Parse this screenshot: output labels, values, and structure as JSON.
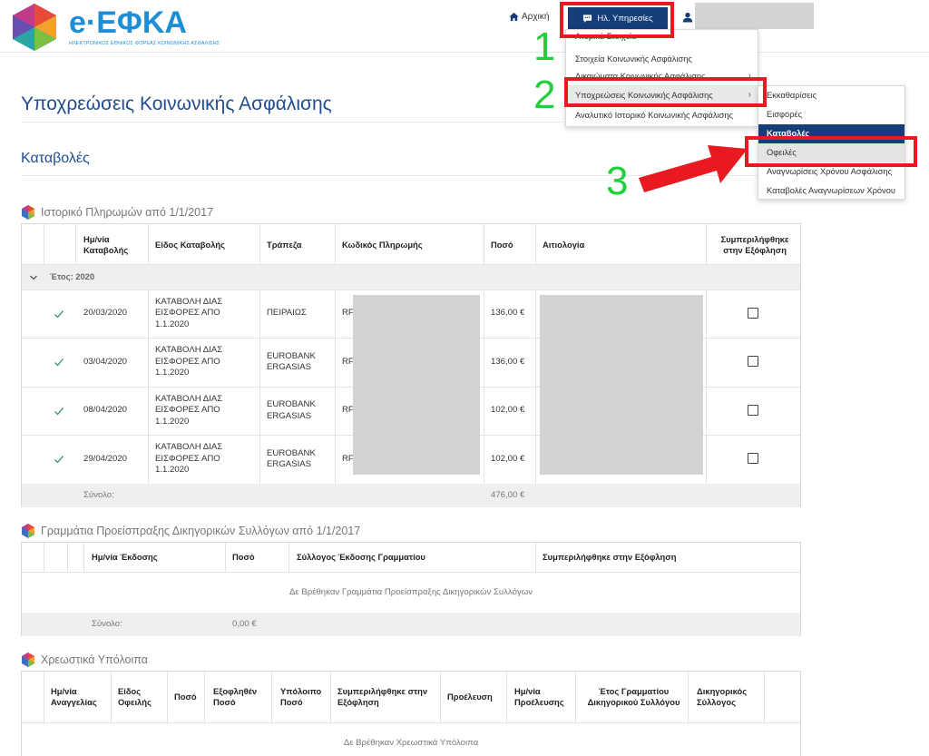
{
  "header": {
    "logo_text": "e·ΕΦΚΑ",
    "logo_subtitle": "ΗΛΕΚΤΡΟΝΙΚΟΣ ΕΘΝΙΚΟΣ ΦΟΡΕΑΣ ΚΟΙΝΩΝΙΚΗΣ ΑΣΦΑΛΙΣΗΣ",
    "home_label": "Αρχική",
    "services_label": "Ηλ. Υπηρεσίες"
  },
  "menu": {
    "items": [
      {
        "label": "Ατομικά Στοιχεία"
      },
      {
        "label": "Στοιχεία Κοινωνικής Ασφάλισης"
      },
      {
        "label": "Δικαιώματα Κοινωνικής Ασφάλισης"
      },
      {
        "label": "Υποχρεώσεις Κοινωνικής Ασφάλισης"
      },
      {
        "label": "Αναλυτικό Ιστορικό Κοινωνικής Ασφάλισης"
      }
    ],
    "chevron": "›",
    "submenu": [
      {
        "label": "Εκκαθαρίσεις"
      },
      {
        "label": "Εισφορές"
      },
      {
        "label": "Καταβολές"
      },
      {
        "label": "Οφειλές"
      },
      {
        "label": "Αναγνωρίσεις Χρόνου Ασφάλισης"
      },
      {
        "label": "Καταβολές Αναγνωρίσεων Χρόνου"
      }
    ]
  },
  "annotations": {
    "n1": "1",
    "n2": "2",
    "n3": "3"
  },
  "page": {
    "title": "Υποχρεώσεις Κοινωνικής Ασφάλισης",
    "section": "Καταβολές"
  },
  "payments": {
    "title": "Ιστορικό Πληρωμών από 1/1/2017",
    "headers": {
      "date": "Ημ/νία Καταβολής",
      "type": "Είδος Καταβολής",
      "bank": "Τράπεζα",
      "code": "Κωδικός Πληρωμής",
      "amount": "Ποσό",
      "reason": "Αιτιολογία",
      "included": "Συμπεριλήφθηκε στην Εξόφληση"
    },
    "group_label": "Έτος: 2020",
    "rows": [
      {
        "date": "20/03/2020",
        "type": "ΚΑΤΑΒΟΛΗ ΔΙΑΣ ΕΙΣΦΟΡΕΣ ΑΠΟ 1.1.2020",
        "bank": "ΠΕΙΡΑΙΩΣ",
        "code": "RF",
        "amount": "136,00 €"
      },
      {
        "date": "03/04/2020",
        "type": "ΚΑΤΑΒΟΛΗ ΔΙΑΣ ΕΙΣΦΟΡΕΣ ΑΠΟ 1.1.2020",
        "bank": "EUROBANK ERGASIAS",
        "code": "RF",
        "amount": "136,00 €"
      },
      {
        "date": "08/04/2020",
        "type": "ΚΑΤΑΒΟΛΗ ΔΙΑΣ ΕΙΣΦΟΡΕΣ ΑΠΟ 1.1.2020",
        "bank": "EUROBANK ERGASIAS",
        "code": "RF",
        "amount": "102,00 €"
      },
      {
        "date": "29/04/2020",
        "type": "ΚΑΤΑΒΟΛΗ ΔΙΑΣ ΕΙΣΦΟΡΕΣ ΑΠΟ 1.1.2020",
        "bank": "EUROBANK ERGASIAS",
        "code": "RF",
        "amount": "102,00 €"
      }
    ],
    "footer_label": "Σύνολο:",
    "footer_total": "476,00 €"
  },
  "lawyers": {
    "title": "Γραμμάτια Προείσπραξης Δικηγορικών Συλλόγων από 1/1/2017",
    "headers": {
      "date": "Ημ/νία Έκδοσης",
      "amount": "Ποσό",
      "association": "Σύλλογος Έκδοσης Γραμματίου",
      "included": "Συμπεριλήφθηκε στην Εξόφληση"
    },
    "empty": "Δε Βρέθηκαν Γραμμάτια Προείσπραξης Δικηγορικών Συλλόγων",
    "footer_label": "Σύνολο:",
    "footer_total": "0,00 €"
  },
  "debits": {
    "title": "Χρεωστικά Υπόλοιπα",
    "headers": {
      "date": "Ημ/νία Αναγγελίας",
      "type": "Είδος Οφειλής",
      "amount": "Ποσό",
      "paid": "Εξοφληθέν Ποσό",
      "balance": "Υπόλοιπο Ποσό",
      "included": "Συμπεριλήφθηκε στην Εξόφληση",
      "origin": "Προέλευση",
      "origin_date": "Ημ/νία Προέλευσης",
      "year": "Έτος Γραμματίου Δικηγορικού Συλλόγου",
      "association": "Δικηγορικός Σύλλογος"
    },
    "empty": "Δε Βρέθηκαν Χρεωστικά Υπόλοιπα"
  },
  "colors": {
    "brand": "#1e8fd6",
    "navy": "#143d7a",
    "title": "#214d8f",
    "annotation_red": "#e8191f",
    "annotation_green": "#1fcf3b",
    "check_green": "#4a9a72"
  }
}
